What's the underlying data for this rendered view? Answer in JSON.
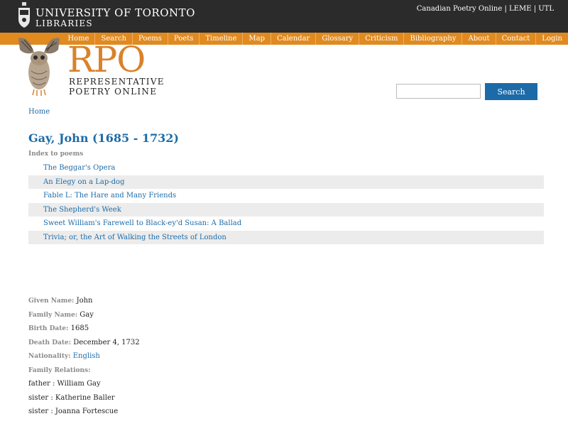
{
  "header": {
    "uoft_line1": "UNIVERSITY OF TORONTO",
    "uoft_line2": "LIBRARIES",
    "top_links": [
      "Canadian Poetry Online",
      "LEME",
      "UTL"
    ],
    "top_link_separator": "|"
  },
  "nav": {
    "items": [
      "Home",
      "Search",
      "Poems",
      "Poets",
      "Timeline",
      "Map",
      "Calendar",
      "Glossary",
      "Criticism",
      "Bibliography",
      "About",
      "Contact",
      "Login"
    ]
  },
  "brand": {
    "logo_text": "RPO",
    "subtitle_line1": "REPRESENTATIVE",
    "subtitle_line2": "POETRY ONLINE"
  },
  "search": {
    "value": "",
    "button_label": "Search"
  },
  "breadcrumb": "Home",
  "page": {
    "title": "Gay, John (1685 - 1732)",
    "index_label": "Index to poems",
    "poems": [
      "The Beggar's Opera",
      "An Elegy on a Lap-dog",
      "Fable L: The Hare and Many Friends",
      "The Shepherd's Week",
      "Sweet William's Farewell to Black-ey'd Susan: A Ballad",
      "Trivia; or, the Art of Walking the Streets of London"
    ]
  },
  "bio": {
    "given_name_label": "Given Name:",
    "given_name": "John",
    "family_name_label": "Family Name:",
    "family_name": "Gay",
    "birth_date_label": "Birth Date:",
    "birth_date": "1685",
    "death_date_label": "Death Date:",
    "death_date": "December 4, 1732",
    "nationality_label": "Nationality:",
    "nationality": "English",
    "relations_label": "Family Relations:",
    "relations": [
      "father : William Gay",
      "sister : Katherine Baller",
      "sister : Joanna Fortescue"
    ]
  },
  "colors": {
    "top_bar": "#2b2b2b",
    "nav_orange": "#e08a20",
    "logo_orange": "#d9822b",
    "link_blue": "#1c6ba8"
  }
}
